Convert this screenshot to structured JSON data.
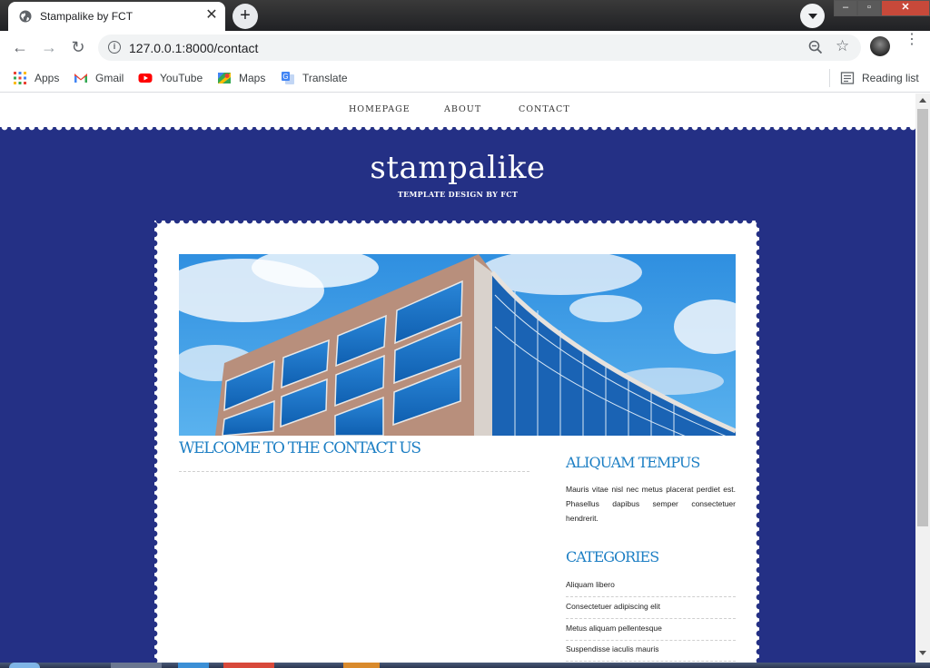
{
  "browser": {
    "tab_title": "Stampalike by FCT",
    "tab_close": "✕",
    "new_tab": "+",
    "url": "127.0.0.1:8000/contact",
    "back": "←",
    "forward": "→",
    "reload": "↻",
    "star": "☆",
    "menu": "⋮",
    "bookmarks": [
      {
        "label": "Apps",
        "icon": "apps-grid-icon"
      },
      {
        "label": "Gmail",
        "icon": "gmail-icon"
      },
      {
        "label": "YouTube",
        "icon": "youtube-icon"
      },
      {
        "label": "Maps",
        "icon": "maps-icon"
      },
      {
        "label": "Translate",
        "icon": "translate-icon"
      }
    ],
    "reading_list": "Reading list",
    "window_controls": {
      "minimize": "–",
      "maximize": "▫",
      "close": "✕"
    }
  },
  "site": {
    "nav": [
      "HOMEPAGE",
      "ABOUT",
      "CONTACT"
    ],
    "logo": "stampalike",
    "tagline": "TEMPLATE DESIGN BY FCT",
    "main_heading": "WELCOME TO THE CONTACT US",
    "sidebar": {
      "heading1": "ALIQUAM TEMPUS",
      "text": "Mauris vitae nisl nec metus placerat perdiet est. Phasellus dapibus semper consectetuer hendrerit.",
      "heading2": "CATEGORIES",
      "categories": [
        "Aliquam libero",
        "Consectetuer adipiscing elit",
        "Metus aliquam pellentesque",
        "Suspendisse iaculis mauris"
      ]
    }
  },
  "colors": {
    "band": "#243085",
    "heading": "#1d7fc4"
  }
}
